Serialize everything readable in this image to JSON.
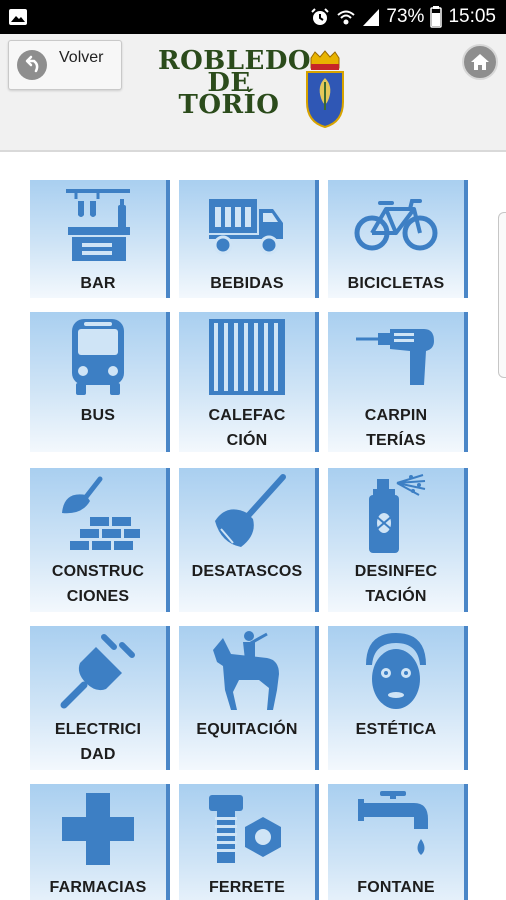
{
  "status_bar": {
    "battery": "73%",
    "time": "15:05",
    "icons": [
      "image-icon",
      "alarm-icon",
      "wifi-icon",
      "signal-icon",
      "battery-icon"
    ]
  },
  "header": {
    "back_label": "Volver",
    "logo_line1": "ROBLEDO",
    "logo_line2": "DE",
    "logo_line3": "TORÍO",
    "home_icon": "home-icon"
  },
  "colors": {
    "icon_blue": "#3d7fc4",
    "tile_top": "#a9cff0",
    "tile_bottom": "#f3f8fd",
    "tile_edge": "#4a86c7"
  },
  "categories": [
    {
      "line1": "BAR",
      "line2": "",
      "icon": "bar-icon"
    },
    {
      "line1": "BEBIDAS",
      "line2": "",
      "icon": "delivery-truck-icon"
    },
    {
      "line1": "BICICLETAS",
      "line2": "",
      "icon": "bicycle-icon"
    },
    {
      "line1": "BUS",
      "line2": "",
      "icon": "bus-icon"
    },
    {
      "line1": "CALEFAC",
      "line2": "CIÓN",
      "icon": "radiator-icon"
    },
    {
      "line1": "CARPIN",
      "line2": "TERÍAS",
      "icon": "drill-icon"
    },
    {
      "line1": "CONSTRUC",
      "line2": "CIONES",
      "icon": "trowel-bricks-icon"
    },
    {
      "line1": "DESATASCOS",
      "line2": "",
      "icon": "plunger-icon"
    },
    {
      "line1": "DESINFEC",
      "line2": "TACIÓN",
      "icon": "bug-spray-icon"
    },
    {
      "line1": "ELECTRICI",
      "line2": "DAD",
      "icon": "plug-icon"
    },
    {
      "line1": "EQUITACIÓN",
      "line2": "",
      "icon": "horse-rider-icon"
    },
    {
      "line1": "ESTÉTICA",
      "line2": "",
      "icon": "face-mask-icon"
    },
    {
      "line1": "FARMACIAS",
      "line2": "",
      "icon": "pharmacy-cross-icon"
    },
    {
      "line1": "FERRETE",
      "line2": "",
      "icon": "bolt-nut-icon"
    },
    {
      "line1": "FONTANE",
      "line2": "",
      "icon": "faucet-icon"
    }
  ]
}
